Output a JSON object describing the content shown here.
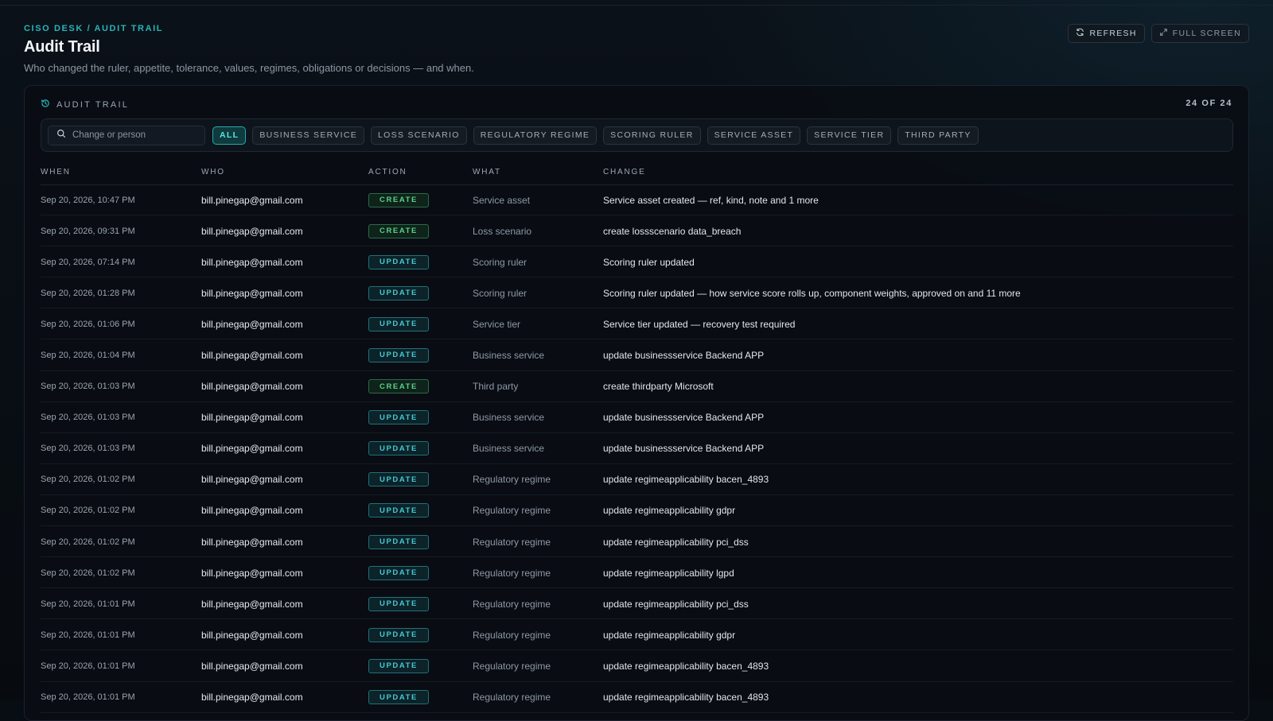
{
  "header": {
    "breadcrumb": "CISO DESK / AUDIT TRAIL",
    "title": "Audit Trail",
    "subtitle": "Who changed the ruler, appetite, tolerance, values, regimes, obligations or decisions — and when.",
    "refresh_label": "REFRESH",
    "fullscreen_label": "FULL SCREEN"
  },
  "panel": {
    "title": "AUDIT TRAIL",
    "count": "24 OF 24"
  },
  "search": {
    "placeholder": "Change or person",
    "value": ""
  },
  "filters": [
    {
      "label": "ALL",
      "active": true
    },
    {
      "label": "BUSINESS SERVICE",
      "active": false
    },
    {
      "label": "LOSS SCENARIO",
      "active": false
    },
    {
      "label": "REGULATORY REGIME",
      "active": false
    },
    {
      "label": "SCORING RULER",
      "active": false
    },
    {
      "label": "SERVICE ASSET",
      "active": false
    },
    {
      "label": "SERVICE TIER",
      "active": false
    },
    {
      "label": "THIRD PARTY",
      "active": false
    }
  ],
  "table": {
    "columns": {
      "when": "WHEN",
      "who": "WHO",
      "action": "ACTION",
      "what": "WHAT",
      "change": "CHANGE"
    },
    "rows": [
      {
        "when": "Sep 20, 2026, 10:47 PM",
        "who": "bill.pinegap@gmail.com",
        "action": "CREATE",
        "what": "Service asset",
        "change": "Service asset created — ref, kind, note and 1 more"
      },
      {
        "when": "Sep 20, 2026, 09:31 PM",
        "who": "bill.pinegap@gmail.com",
        "action": "CREATE",
        "what": "Loss scenario",
        "change": "create lossscenario data_breach"
      },
      {
        "when": "Sep 20, 2026, 07:14 PM",
        "who": "bill.pinegap@gmail.com",
        "action": "UPDATE",
        "what": "Scoring ruler",
        "change": "Scoring ruler updated"
      },
      {
        "when": "Sep 20, 2026, 01:28 PM",
        "who": "bill.pinegap@gmail.com",
        "action": "UPDATE",
        "what": "Scoring ruler",
        "change": "Scoring ruler updated — how service score rolls up, component weights, approved on and 11 more"
      },
      {
        "when": "Sep 20, 2026, 01:06 PM",
        "who": "bill.pinegap@gmail.com",
        "action": "UPDATE",
        "what": "Service tier",
        "change": "Service tier updated — recovery test required"
      },
      {
        "when": "Sep 20, 2026, 01:04 PM",
        "who": "bill.pinegap@gmail.com",
        "action": "UPDATE",
        "what": "Business service",
        "change": "update businessservice Backend APP"
      },
      {
        "when": "Sep 20, 2026, 01:03 PM",
        "who": "bill.pinegap@gmail.com",
        "action": "CREATE",
        "what": "Third party",
        "change": "create thirdparty Microsoft"
      },
      {
        "when": "Sep 20, 2026, 01:03 PM",
        "who": "bill.pinegap@gmail.com",
        "action": "UPDATE",
        "what": "Business service",
        "change": "update businessservice Backend APP"
      },
      {
        "when": "Sep 20, 2026, 01:03 PM",
        "who": "bill.pinegap@gmail.com",
        "action": "UPDATE",
        "what": "Business service",
        "change": "update businessservice Backend APP"
      },
      {
        "when": "Sep 20, 2026, 01:02 PM",
        "who": "bill.pinegap@gmail.com",
        "action": "UPDATE",
        "what": "Regulatory regime",
        "change": "update regimeapplicability bacen_4893"
      },
      {
        "when": "Sep 20, 2026, 01:02 PM",
        "who": "bill.pinegap@gmail.com",
        "action": "UPDATE",
        "what": "Regulatory regime",
        "change": "update regimeapplicability gdpr"
      },
      {
        "when": "Sep 20, 2026, 01:02 PM",
        "who": "bill.pinegap@gmail.com",
        "action": "UPDATE",
        "what": "Regulatory regime",
        "change": "update regimeapplicability pci_dss"
      },
      {
        "when": "Sep 20, 2026, 01:02 PM",
        "who": "bill.pinegap@gmail.com",
        "action": "UPDATE",
        "what": "Regulatory regime",
        "change": "update regimeapplicability lgpd"
      },
      {
        "when": "Sep 20, 2026, 01:01 PM",
        "who": "bill.pinegap@gmail.com",
        "action": "UPDATE",
        "what": "Regulatory regime",
        "change": "update regimeapplicability pci_dss"
      },
      {
        "when": "Sep 20, 2026, 01:01 PM",
        "who": "bill.pinegap@gmail.com",
        "action": "UPDATE",
        "what": "Regulatory regime",
        "change": "update regimeapplicability gdpr"
      },
      {
        "when": "Sep 20, 2026, 01:01 PM",
        "who": "bill.pinegap@gmail.com",
        "action": "UPDATE",
        "what": "Regulatory regime",
        "change": "update regimeapplicability bacen_4893"
      },
      {
        "when": "Sep 20, 2026, 01:01 PM",
        "who": "bill.pinegap@gmail.com",
        "action": "UPDATE",
        "what": "Regulatory regime",
        "change": "update regimeapplicability bacen_4893"
      }
    ]
  },
  "icons": {
    "refresh": "refresh-icon",
    "fullscreen": "expand-icon",
    "history": "history-icon",
    "search": "search-icon"
  },
  "colors": {
    "accent": "#2ab3b8",
    "create": "#5ccf8a",
    "update": "#49c6d0",
    "background": "#080d13"
  }
}
